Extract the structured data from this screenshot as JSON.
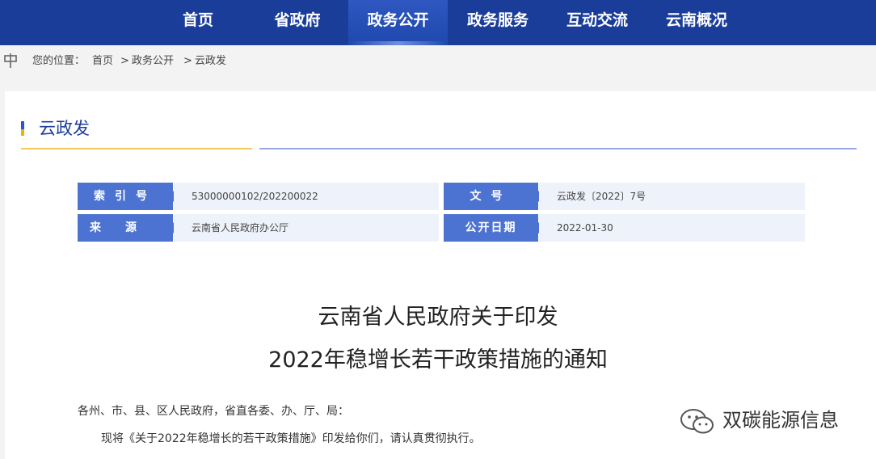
{
  "nav": {
    "items": [
      {
        "label": "首页"
      },
      {
        "label": "省政府"
      },
      {
        "label": "政务公开"
      },
      {
        "label": "政务服务"
      },
      {
        "label": "互动交流"
      },
      {
        "label": "云南概况"
      }
    ],
    "active_index": 2
  },
  "breadcrumb": {
    "prefix": "您的位置：",
    "items": [
      "首页",
      "政务公开",
      "云政发"
    ],
    "separator": ">"
  },
  "section": {
    "title": "云政发"
  },
  "meta": {
    "index_label": "索引号",
    "index_value": "53000000102/202200022",
    "docno_label": "文号",
    "docno_value": "云政发〔2022〕7号",
    "source_label": "来源",
    "source_value": "云南省人民政府办公厅",
    "date_label": "公开日期",
    "date_value": "2022-01-30"
  },
  "document": {
    "title_line1": "云南省人民政府关于印发",
    "title_line2": "2022年稳增长若干政策措施的通知",
    "salutation": "各州、市、县、区人民政府，省直各委、办、厅、局：",
    "paragraph1": "现将《关于2022年稳增长的若干政策措施》印发给你们，请认真贯彻执行。"
  },
  "watermark": {
    "text": "双碳能源信息",
    "icon": "wechat-icon"
  },
  "colors": {
    "nav_bg": "#1a3d9a",
    "label_bg": "#4c73d2",
    "value_bg": "#eef2fa",
    "accent_gold": "#f2c85b"
  }
}
